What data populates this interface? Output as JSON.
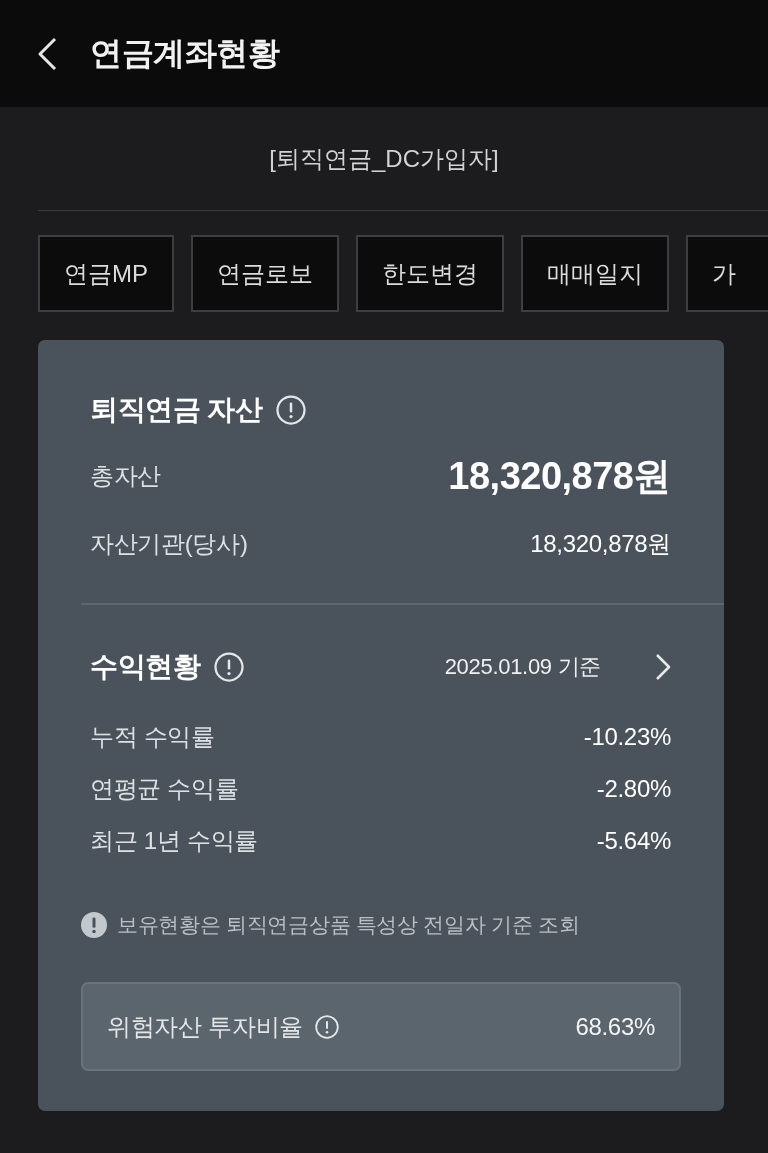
{
  "header": {
    "title": "연금계좌현황"
  },
  "account_type": "[퇴직연금_DC가입자]",
  "shortcuts": [
    {
      "label": "연금MP"
    },
    {
      "label": "연금로보"
    },
    {
      "label": "한도변경"
    },
    {
      "label": "매매일지"
    },
    {
      "label": "가"
    }
  ],
  "assets": {
    "title": "퇴직연금 자산",
    "rows": [
      {
        "kind": "total",
        "label": "총자산",
        "value": "18,320,878원"
      },
      {
        "kind": "detail",
        "label": "자산기관(당사)",
        "value": "18,320,878원"
      }
    ]
  },
  "returns": {
    "title": "수익현황",
    "as_of": "2025.01.09 기준",
    "rows": [
      {
        "label": "누적 수익률",
        "value": "-10.23%"
      },
      {
        "label": "연평균 수익률",
        "value": "-2.80%"
      },
      {
        "label": "최근 1년 수익률",
        "value": "-5.64%"
      }
    ]
  },
  "notice": "보유현황은 퇴직연금상품 특성상 전일자 기준 조회",
  "risk_ratio": {
    "label": "위험자산 투자비율",
    "value": "68.63%"
  }
}
